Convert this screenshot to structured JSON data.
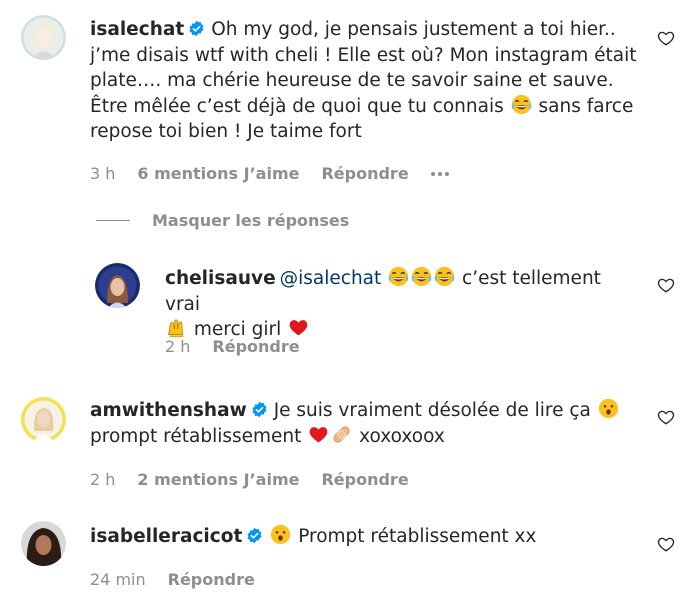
{
  "comments": [
    {
      "username": "isalechat",
      "verified": true,
      "text_parts": [
        "Oh my god, je pensais justement a toi hier.. j’me disais wtf with cheli ! Elle est où? Mon instagram était plate…. ma chérie heureuse de te savoir saine et sauve. Être mêlée c’est déjà de quoi que tu connais ",
        " sans farce repose toi bien ! Je taime fort"
      ],
      "time": "3 h",
      "likes": "6 mentions J’aime",
      "reply": "Répondre"
    },
    {
      "username": "chelisauve",
      "verified": false,
      "mention": "@isalechat",
      "text_parts": [
        " c’est tellement vrai",
        " merci girl"
      ],
      "time": "2 h",
      "reply": "Répondre"
    },
    {
      "username": "amwithenshaw",
      "verified": true,
      "text_parts": [
        "Je suis vraiment désolée de lire ça ",
        "prompt rétablissement ",
        " xoxoxoox"
      ],
      "time": "2 h",
      "likes": "2 mentions J’aime",
      "reply": "Répondre"
    },
    {
      "username": "isabelleracicot",
      "verified": true,
      "text_parts": [
        "Prompt rétablissement xx"
      ],
      "time": "24 min",
      "reply": "Répondre"
    }
  ],
  "hide_replies_label": "Masquer les réponses",
  "colors": {
    "text": "#262626",
    "meta": "#8e8e8e",
    "mention": "#00376b",
    "verified": "#0095f6"
  }
}
